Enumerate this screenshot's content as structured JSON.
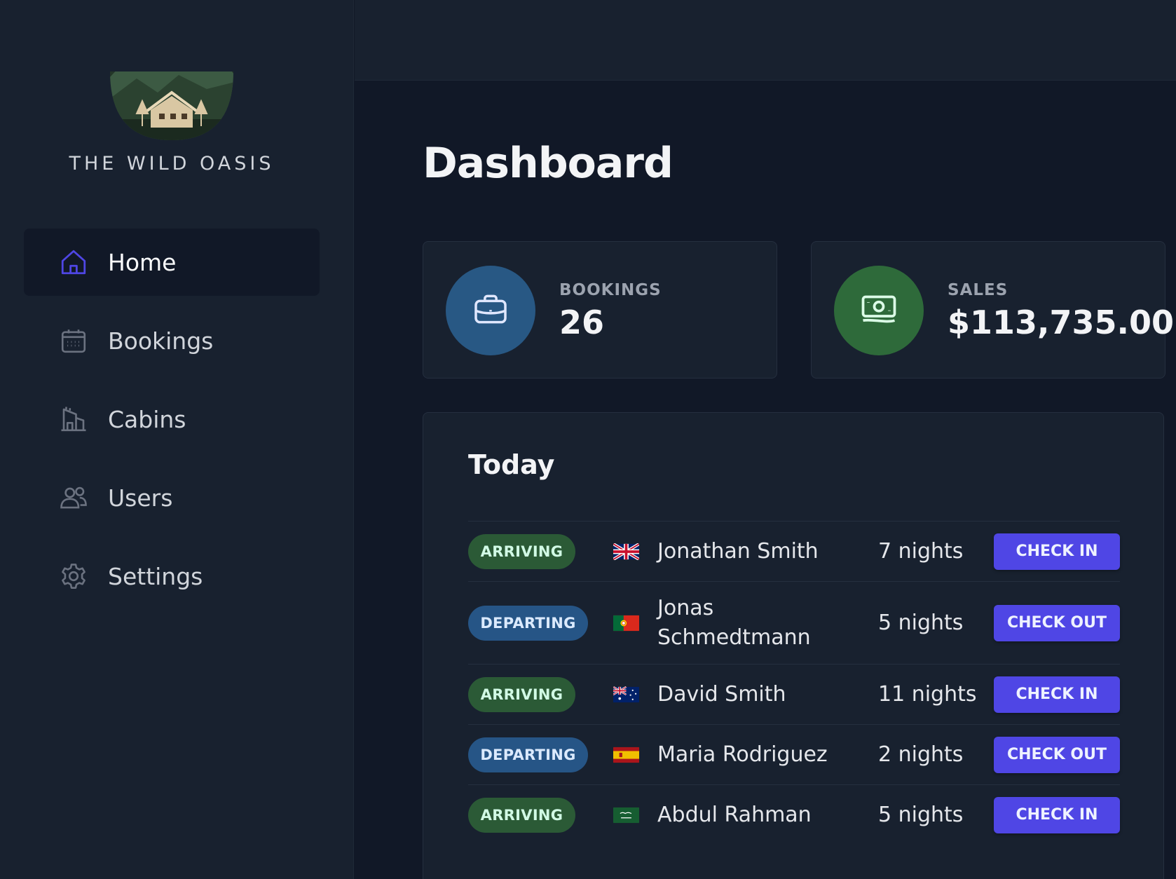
{
  "brand": {
    "name": "THE WILD OASIS"
  },
  "nav": {
    "items": [
      {
        "label": "Home",
        "icon": "home-icon",
        "active": true
      },
      {
        "label": "Bookings",
        "icon": "calendar-icon"
      },
      {
        "label": "Cabins",
        "icon": "building-icon"
      },
      {
        "label": "Users",
        "icon": "users-icon"
      },
      {
        "label": "Settings",
        "icon": "gear-icon"
      }
    ]
  },
  "page": {
    "title": "Dashboard"
  },
  "stats": [
    {
      "label": "BOOKINGS",
      "value": "26",
      "icon": "briefcase-icon",
      "color": "#285884"
    },
    {
      "label": "SALES",
      "value": "$113,735.00",
      "icon": "banknote-icon",
      "color": "#2e6a3a"
    }
  ],
  "today": {
    "title": "Today",
    "rows": [
      {
        "status": "ARRIVING",
        "flag": "uk-flag-icon",
        "guest": "Jonathan Smith",
        "nights": "7 nights",
        "action": "CHECK IN"
      },
      {
        "status": "DEPARTING",
        "flag": "portugal-flag-icon",
        "guest": "Jonas Schmedtmann",
        "nights": "5 nights",
        "action": "CHECK OUT"
      },
      {
        "status": "ARRIVING",
        "flag": "australia-flag-icon",
        "guest": "David Smith",
        "nights": "11 nights",
        "action": "CHECK IN"
      },
      {
        "status": "DEPARTING",
        "flag": "spain-flag-icon",
        "guest": "Maria Rodriguez",
        "nights": "2 nights",
        "action": "CHECK OUT"
      },
      {
        "status": "ARRIVING",
        "flag": "saudi-arabia-flag-icon",
        "guest": "Abdul Rahman",
        "nights": "5 nights",
        "action": "CHECK IN"
      }
    ]
  },
  "colors": {
    "accent": "#4f46e5",
    "arriving": "#2b5a36",
    "departing": "#265586",
    "background": "#111827",
    "panel": "#18212f"
  }
}
